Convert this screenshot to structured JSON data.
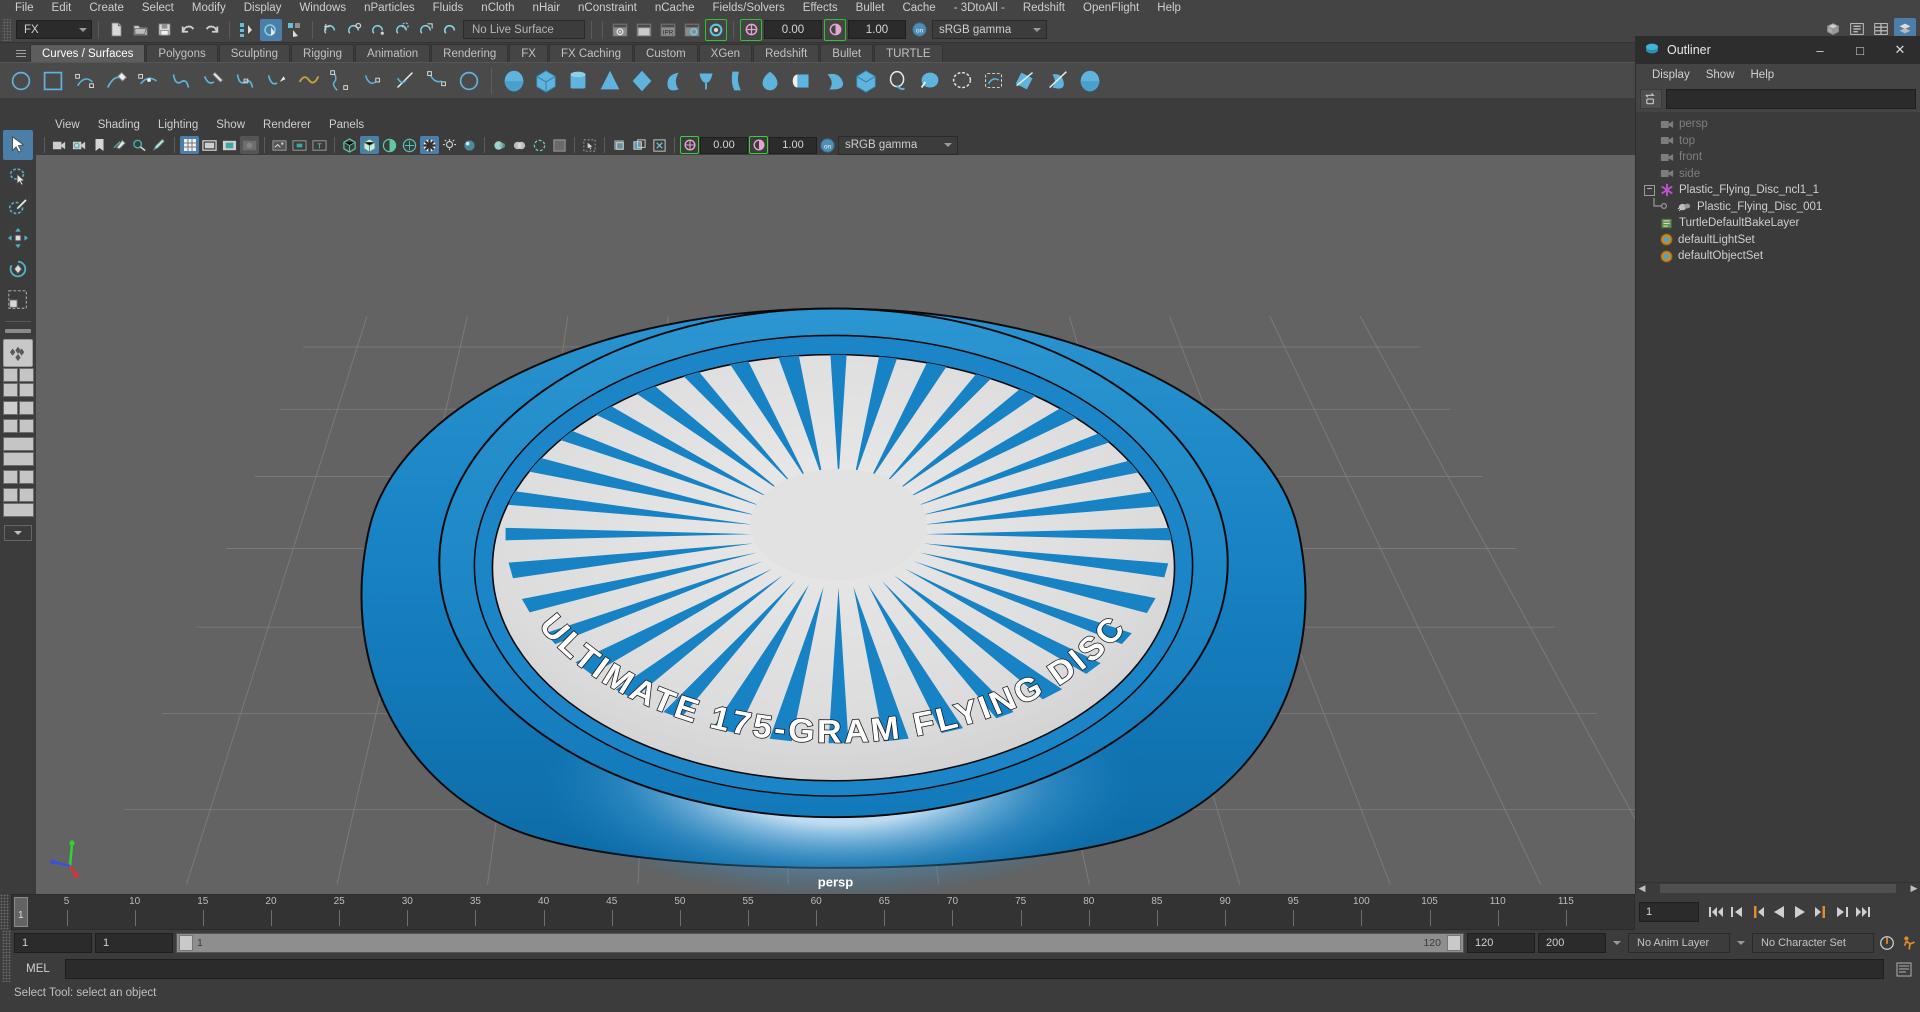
{
  "app": {
    "menu_items": [
      "File",
      "Edit",
      "Create",
      "Select",
      "Modify",
      "Display",
      "Windows",
      "nParticles",
      "Fluids",
      "nCloth",
      "nHair",
      "nConstraint",
      "nCache",
      "Fields/Solvers",
      "Effects",
      "Bullet",
      "Cache",
      "- 3DtoAll -",
      "Redshift",
      "OpenFlight",
      "Help"
    ]
  },
  "status_line": {
    "menu_set": "FX",
    "live_surface": "No Live Surface",
    "gamma_low": "0.00",
    "gamma_high": "1.00",
    "color_space": "sRGB gamma"
  },
  "shelf": {
    "tabs": [
      "Curves / Surfaces",
      "Polygons",
      "Sculpting",
      "Rigging",
      "Animation",
      "Rendering",
      "FX",
      "FX Caching",
      "Custom",
      "XGen",
      "Redshift",
      "Bullet",
      "TURTLE"
    ],
    "selected_tab": "Curves / Surfaces",
    "icons": [
      "nurbs-circle-icon",
      "nurbs-square-icon",
      "cv-curve-tool-icon",
      "pencil-curve-tool-icon",
      "ep-curve-tool-icon",
      "bezier-curve-tool-icon",
      "three-point-arc-icon",
      "attach-curves-icon",
      "detach-curves-icon",
      "insert-knot-icon",
      "offset-curve-icon",
      "curve-fillet-icon",
      "rebuild-curve-icon",
      "cut-curve-icon",
      "curve-editing-tool-icon",
      "nurbs-sphere-icon",
      "nurbs-cube-icon",
      "nurbs-cylinder-icon",
      "nurbs-cone-icon",
      "nurbs-plane-icon",
      "nurbs-torus-icon",
      "revolve-icon",
      "loft-icon",
      "planar-icon",
      "extrude-icon",
      "birail-icon",
      "boundary-icon",
      "square-surface-icon",
      "intersect-surfaces-icon",
      "project-curve-icon",
      "trim-tool-icon",
      "untrim-icon",
      "sculpt-geometry-icon",
      "surface-fillet-icon"
    ]
  },
  "toolbox": {
    "tools": [
      {
        "name": "select-tool",
        "selected": true
      },
      {
        "name": "lasso-select-tool",
        "selected": false
      },
      {
        "name": "paint-select-tool",
        "selected": false
      },
      {
        "name": "move-tool",
        "selected": false
      },
      {
        "name": "rotate-tool",
        "selected": false
      },
      {
        "name": "scale-tool",
        "selected": false
      },
      {
        "name": "last-tool-used",
        "selected": false
      }
    ],
    "layout_presets": [
      "single-perspective-layout",
      "four-view-layout",
      "persp-outliner-layout",
      "persp-graph-layout",
      "hypershade-layout",
      "persp-uv-layout",
      "persp-render-layout"
    ]
  },
  "viewport": {
    "menus": [
      "View",
      "Shading",
      "Lighting",
      "Show",
      "Renderer",
      "Panels"
    ],
    "camera_label": "persp",
    "exposure": "0.00",
    "gamma": "1.00",
    "color_space": "sRGB gamma",
    "grid_color": "#636363",
    "model": {
      "name": "Plastic Flying Disc",
      "body_color": "#1782c4",
      "body_color_dark": "#0f6ca6",
      "face_color": "#dcdcdc",
      "ray_color": "#1782c4",
      "ray_count": 36,
      "rim_text": "ULTIMATE 175-GRAM FLYING DISC",
      "highlight_color": "#eaf4ff"
    }
  },
  "outliner": {
    "title": "Outliner",
    "menus": [
      "Display",
      "Show",
      "Help"
    ],
    "search_value": "",
    "window_buttons": [
      "minimize",
      "maximize",
      "close"
    ],
    "items": [
      {
        "label": "persp",
        "icon": "camera-icon",
        "indent": 1,
        "dim": true,
        "expander": false
      },
      {
        "label": "top",
        "icon": "camera-icon",
        "indent": 1,
        "dim": true,
        "expander": false
      },
      {
        "label": "front",
        "icon": "camera-icon",
        "indent": 1,
        "dim": true,
        "expander": false
      },
      {
        "label": "side",
        "icon": "camera-icon",
        "indent": 1,
        "dim": true,
        "expander": false
      },
      {
        "label": "Plastic_Flying_Disc_ncl1_1",
        "icon": "nucleus-icon",
        "indent": 1,
        "dim": false,
        "expander": true,
        "expander_glyph": "−"
      },
      {
        "label": "Plastic_Flying_Disc_001",
        "icon": "mesh-icon",
        "indent": 2,
        "dim": false,
        "expander": false,
        "connector": true
      },
      {
        "label": "TurtleDefaultBakeLayer",
        "icon": "turtle-icon",
        "indent": 1,
        "dim": false,
        "expander": false
      },
      {
        "label": "defaultLightSet",
        "icon": "set-icon",
        "indent": 1,
        "dim": false,
        "expander": false
      },
      {
        "label": "defaultObjectSet",
        "icon": "set-icon",
        "indent": 1,
        "dim": false,
        "expander": false
      }
    ]
  },
  "timeline": {
    "start_label": "1",
    "current_frame": "1",
    "frame_field": "1",
    "ticks": [
      5,
      10,
      15,
      20,
      25,
      30,
      35,
      40,
      45,
      50,
      55,
      60,
      65,
      70,
      75,
      80,
      85,
      90,
      95,
      100,
      105,
      110,
      115
    ],
    "tick_min": 1,
    "tick_max": 120,
    "playback_buttons": [
      "go-to-start",
      "step-back-keyframe",
      "step-back-frame",
      "play-backwards",
      "play-forwards",
      "step-forward-frame",
      "step-forward-keyframe",
      "go-to-end"
    ]
  },
  "range_slider": {
    "anim_start": "1",
    "anim_current": "1",
    "range_start": "1",
    "range_end": "120",
    "playback_end": "120",
    "anim_end": "200",
    "anim_layer": "No Anim Layer",
    "character_set": "No Character Set"
  },
  "command_line": {
    "language": "MEL",
    "command_value": "",
    "help_text": "Select Tool: select an object"
  }
}
